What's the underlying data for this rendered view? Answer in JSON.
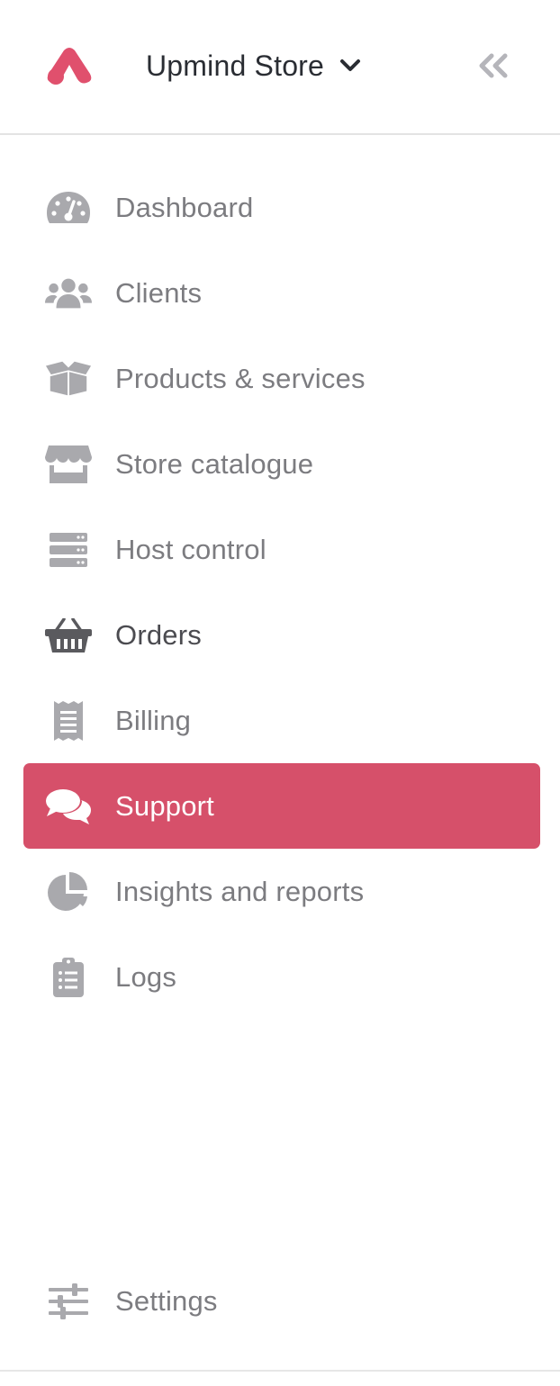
{
  "header": {
    "store_name": "Upmind Store",
    "logo_icon": "upmind-logo-icon",
    "dropdown_icon": "chevron-down-icon",
    "collapse_icon": "double-chevron-left-icon",
    "brand_color": "#e0506d"
  },
  "nav": {
    "items": [
      {
        "label": "Dashboard",
        "icon": "gauge-icon"
      },
      {
        "label": "Clients",
        "icon": "users-icon"
      },
      {
        "label": "Products & services",
        "icon": "open-box-icon"
      },
      {
        "label": "Store catalogue",
        "icon": "storefront-icon"
      },
      {
        "label": "Host control",
        "icon": "server-icon"
      },
      {
        "label": "Orders",
        "icon": "basket-icon"
      },
      {
        "label": "Billing",
        "icon": "receipt-icon"
      },
      {
        "label": "Support",
        "icon": "chat-bubbles-icon",
        "active": true
      },
      {
        "label": "Insights and reports",
        "icon": "pie-chart-icon"
      },
      {
        "label": "Logs",
        "icon": "clipboard-list-icon"
      }
    ],
    "active_color": "#d6506a",
    "icon_color": "#a9a9ad",
    "label_color": "#7c7c80"
  },
  "footer": {
    "settings_label": "Settings",
    "settings_icon": "sliders-icon"
  }
}
